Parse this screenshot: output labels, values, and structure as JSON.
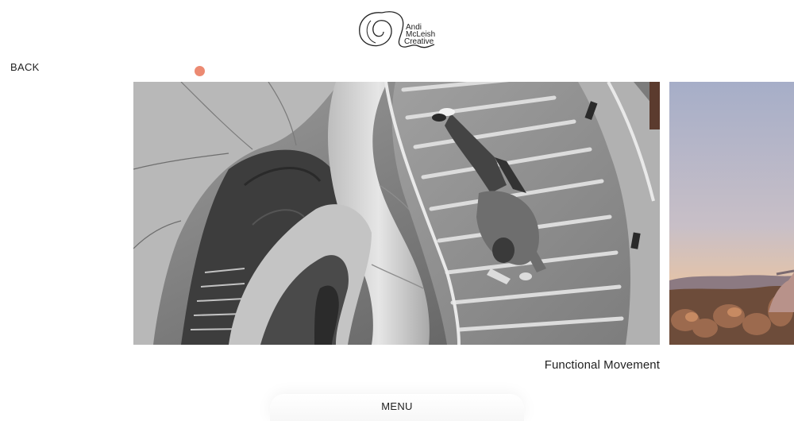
{
  "brand": {
    "logo_line1": "Andi",
    "logo_line2": "McLeish",
    "logo_line3": "Creative"
  },
  "nav": {
    "back_label": "BACK",
    "menu_label": "MENU"
  },
  "gallery": {
    "current_caption": "Functional Movement"
  },
  "colors": {
    "accent_dot": "#ec8a72",
    "text": "#222222",
    "background": "#ffffff"
  }
}
